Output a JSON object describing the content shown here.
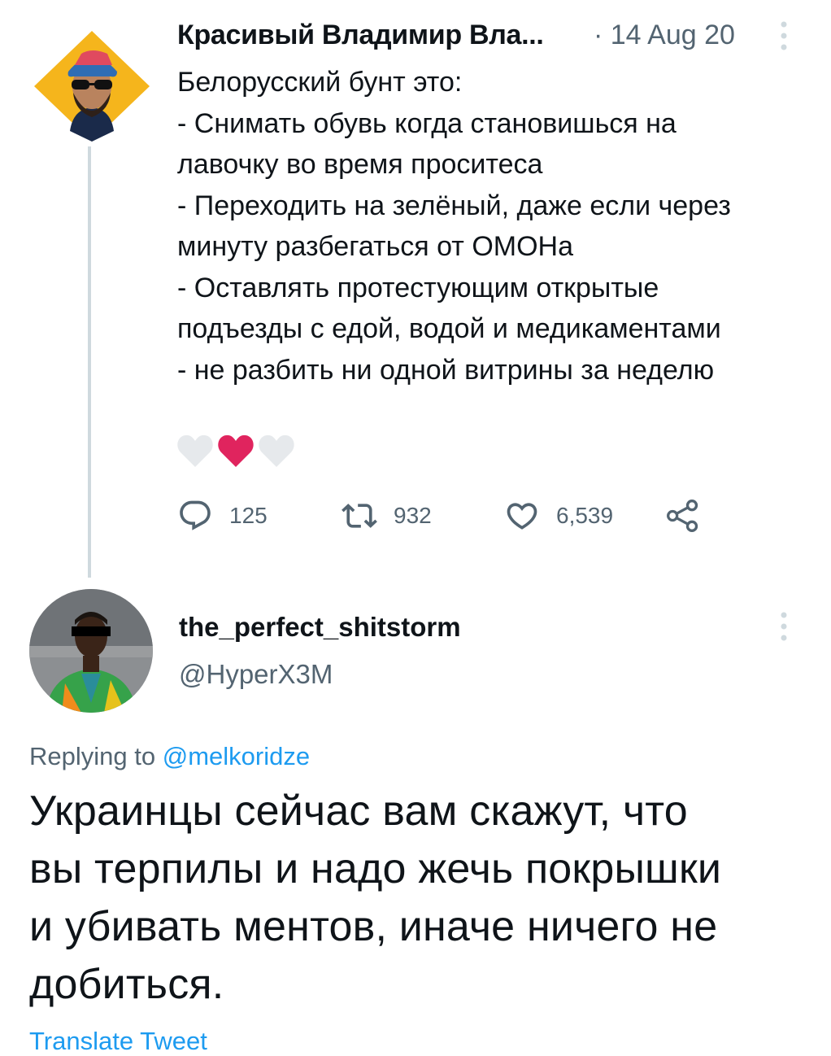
{
  "tweet": {
    "author": "Красивый Владимир Вла...",
    "date": "· 14 Aug 20",
    "body_lines": [
      "Белорусский бунт это:",
      "- Снимать обувь когда становишься на",
      "лавочку во время проситеса",
      "- Переходить на зелёный, даже если через",
      "минуту разбегаться от ОМОНа",
      "- Оставлять протестующим открытые",
      "подъезды с едой, водой и медикаментами",
      "- не разбить ни одной витрины за неделю"
    ],
    "stats": {
      "replies": "125",
      "retweets": "932",
      "likes": "6,539"
    },
    "colors": {
      "heart_liked": "#e0245e",
      "heart_plain": "#e6e9ec",
      "thread_line": "#cfd9de"
    }
  },
  "reply": {
    "display_name": "the_perfect_shitstorm",
    "handle": "@HyperX3M",
    "replying_to_prefix": "Replying to",
    "replying_to_user": "@melkoridze",
    "body_lines": [
      "Украинцы сейчас вам скажут, что",
      "вы терпилы и надо жечь покрышки",
      "и убивать ментов, иначе ничего не",
      "добиться."
    ],
    "translate_link": "Translate Tweet"
  },
  "colors": {
    "text_primary": "#0f1419",
    "text_secondary": "#536471",
    "link": "#1d9bf0"
  },
  "icons": [
    "more-icon",
    "reply-icon",
    "retweet-icon",
    "like-icon",
    "share-icon"
  ]
}
